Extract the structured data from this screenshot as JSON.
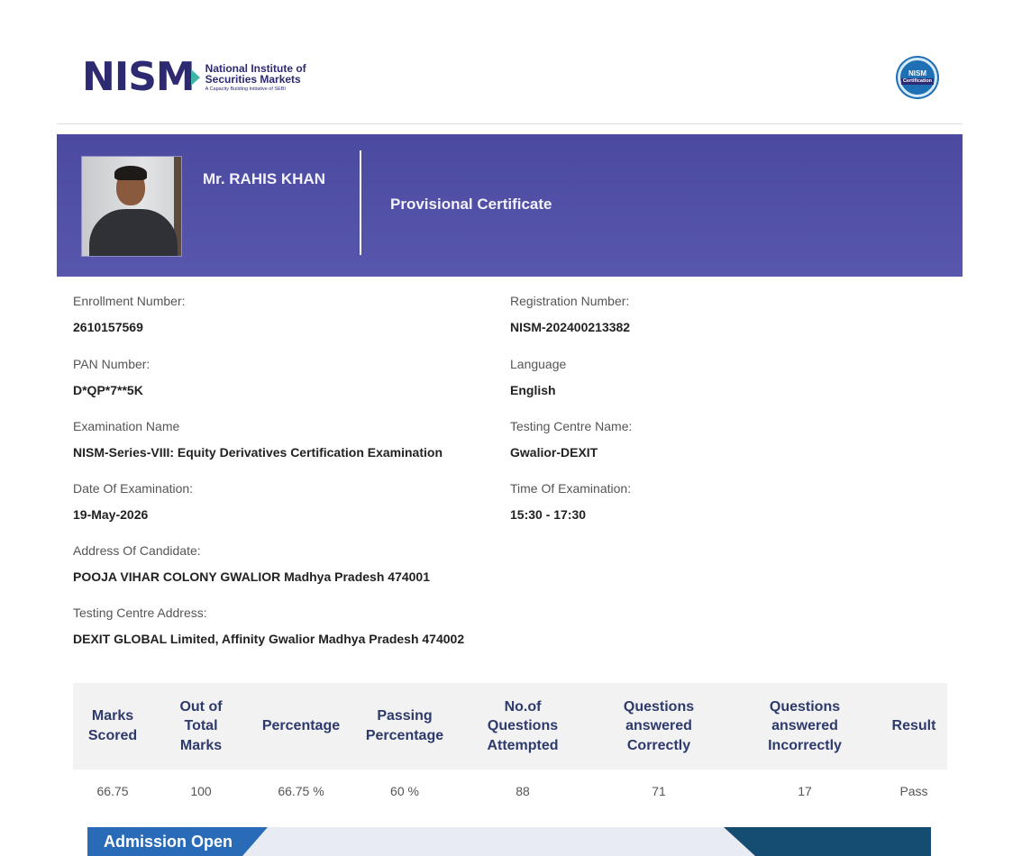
{
  "header": {
    "logo_mark": "NISM",
    "logo_line1": "National Institute of",
    "logo_line2": "Securities Markets",
    "logo_line3": "A Capacity Building Initiative of SEBI",
    "badge_line1": "NISM",
    "badge_line2": "Certification"
  },
  "banner": {
    "candidate_name": "Mr. RAHIS KHAN",
    "certificate_title": "Provisional Certificate"
  },
  "details": {
    "enrollment": {
      "label": "Enrollment Number:",
      "value": "2610157569"
    },
    "registration": {
      "label": "Registration Number:",
      "value": "NISM-202400213382"
    },
    "pan": {
      "label": "PAN Number:",
      "value": "D*QP*7**5K"
    },
    "language": {
      "label": "Language",
      "value": "English"
    },
    "exam_name": {
      "label": "Examination Name",
      "value": "NISM-Series-VIII: Equity Derivatives Certification Examination"
    },
    "centre_name": {
      "label": "Testing Centre Name:",
      "value": "Gwalior-DEXIT"
    },
    "exam_date": {
      "label": "Date Of Examination:",
      "value": "19-May-2026"
    },
    "exam_time": {
      "label": "Time Of Examination:",
      "value": "15:30 - 17:30"
    },
    "candidate_address": {
      "label": "Address Of Candidate:",
      "value": "POOJA VIHAR COLONY GWALIOR Madhya Pradesh 474001"
    },
    "centre_address": {
      "label": "Testing Centre Address:",
      "value": "DEXIT GLOBAL Limited, Affinity Gwalior Madhya Pradesh 474002"
    }
  },
  "results": {
    "headers": [
      [
        "Marks",
        "Scored"
      ],
      [
        "Out of",
        "Total",
        "Marks"
      ],
      [
        "Percentage"
      ],
      [
        "Passing",
        "Percentage"
      ],
      [
        "No.of",
        "Questions",
        "Attempted"
      ],
      [
        "Questions",
        "answered",
        "Correctly"
      ],
      [
        "Questions",
        "answered",
        "Incorrectly"
      ],
      [
        "Result"
      ]
    ],
    "values": [
      "66.75",
      "100",
      "66.75 %",
      "60 %",
      "88",
      "71",
      "17",
      "Pass"
    ]
  },
  "promo": {
    "label": "Admission Open"
  }
}
